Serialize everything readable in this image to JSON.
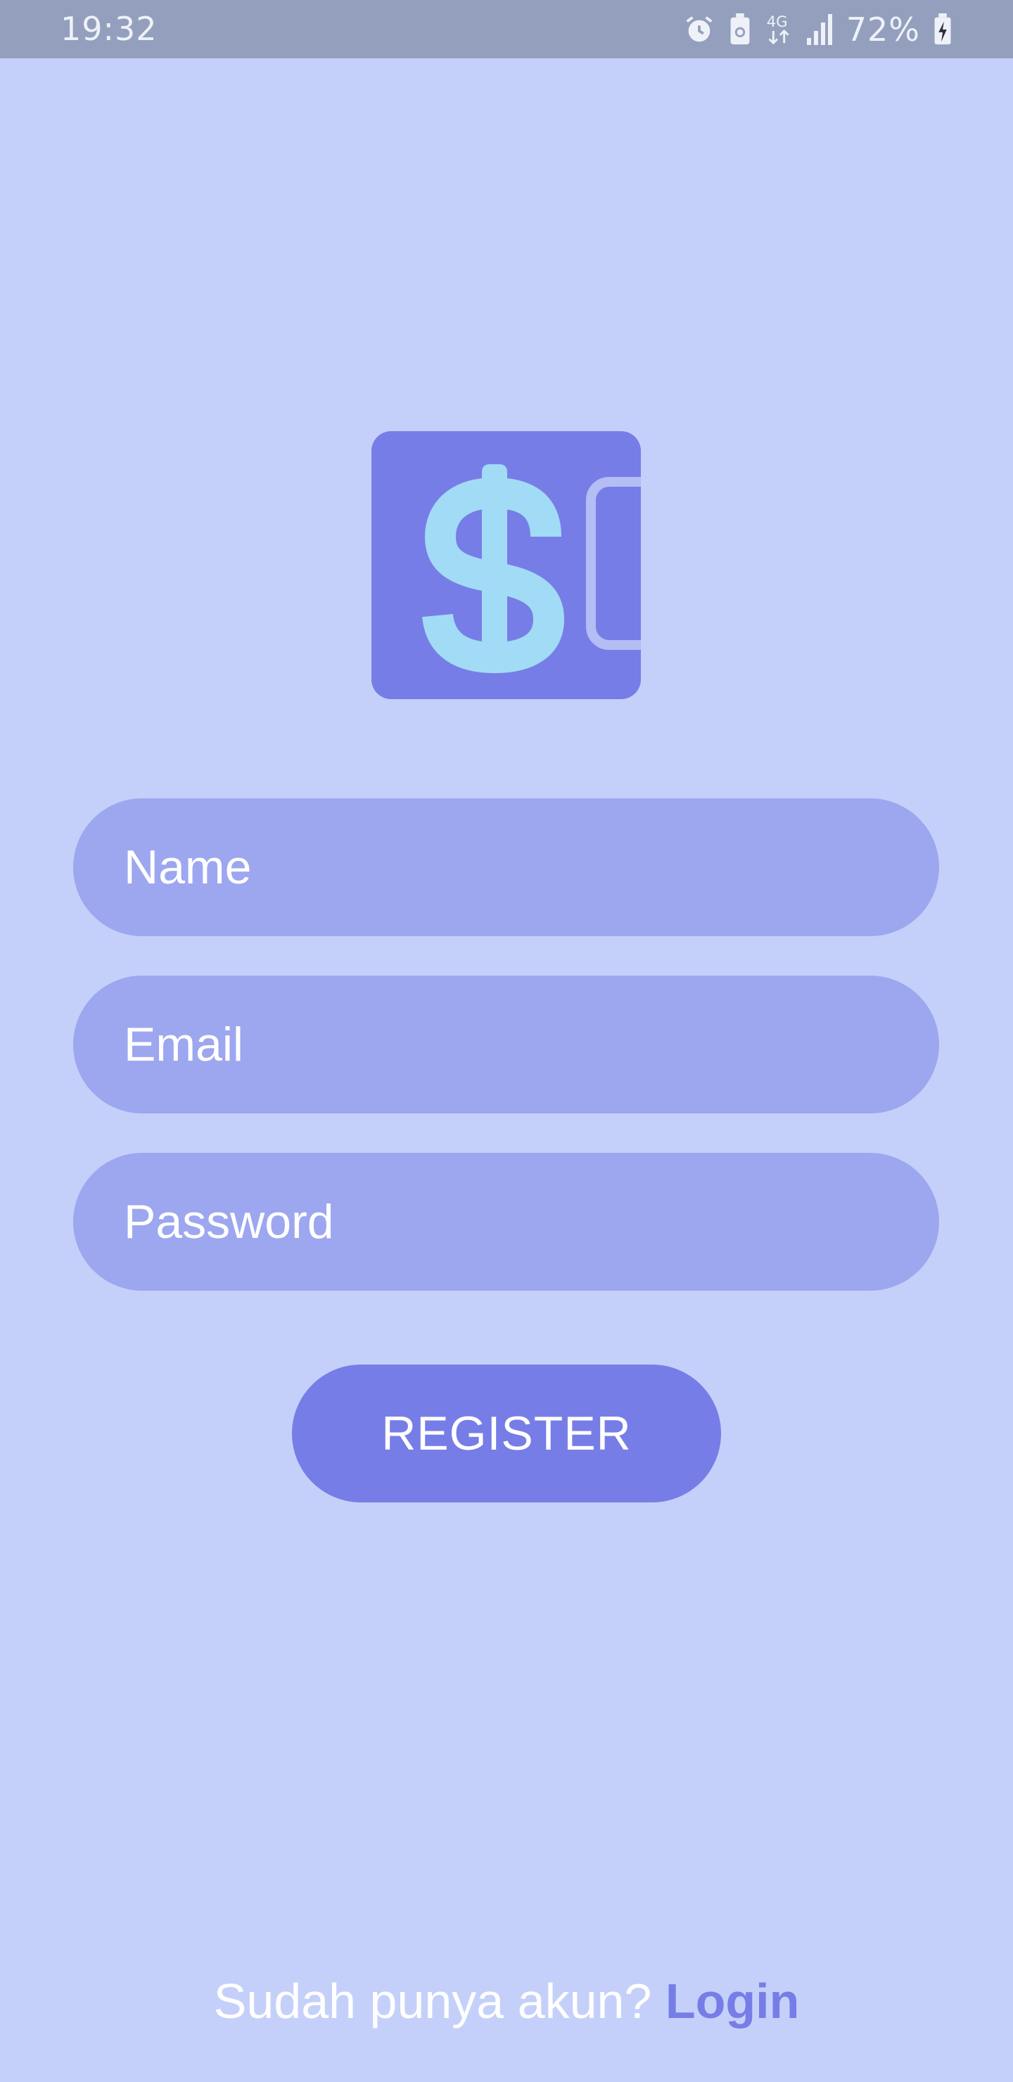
{
  "status_bar": {
    "time": "19:32",
    "network": "4G",
    "battery_percent": "72%",
    "icons": [
      "alarm-icon",
      "battery-saver-icon",
      "network-4g-icon",
      "signal-icon",
      "battery-charging-icon"
    ]
  },
  "logo": {
    "icon": "dollar-wallet-logo",
    "colors": {
      "background": "#777de6",
      "symbol": "#a2dbf5"
    }
  },
  "form": {
    "name_placeholder": "Name",
    "email_placeholder": "Email",
    "password_placeholder": "Password",
    "register_label": "REGISTER"
  },
  "footer": {
    "prompt": "Sudah punya akun?",
    "login_label": "Login"
  },
  "colors": {
    "background": "#c5d0fa",
    "field": "#9da7ef",
    "accent": "#777de6",
    "status_bar": "#939fbd"
  }
}
